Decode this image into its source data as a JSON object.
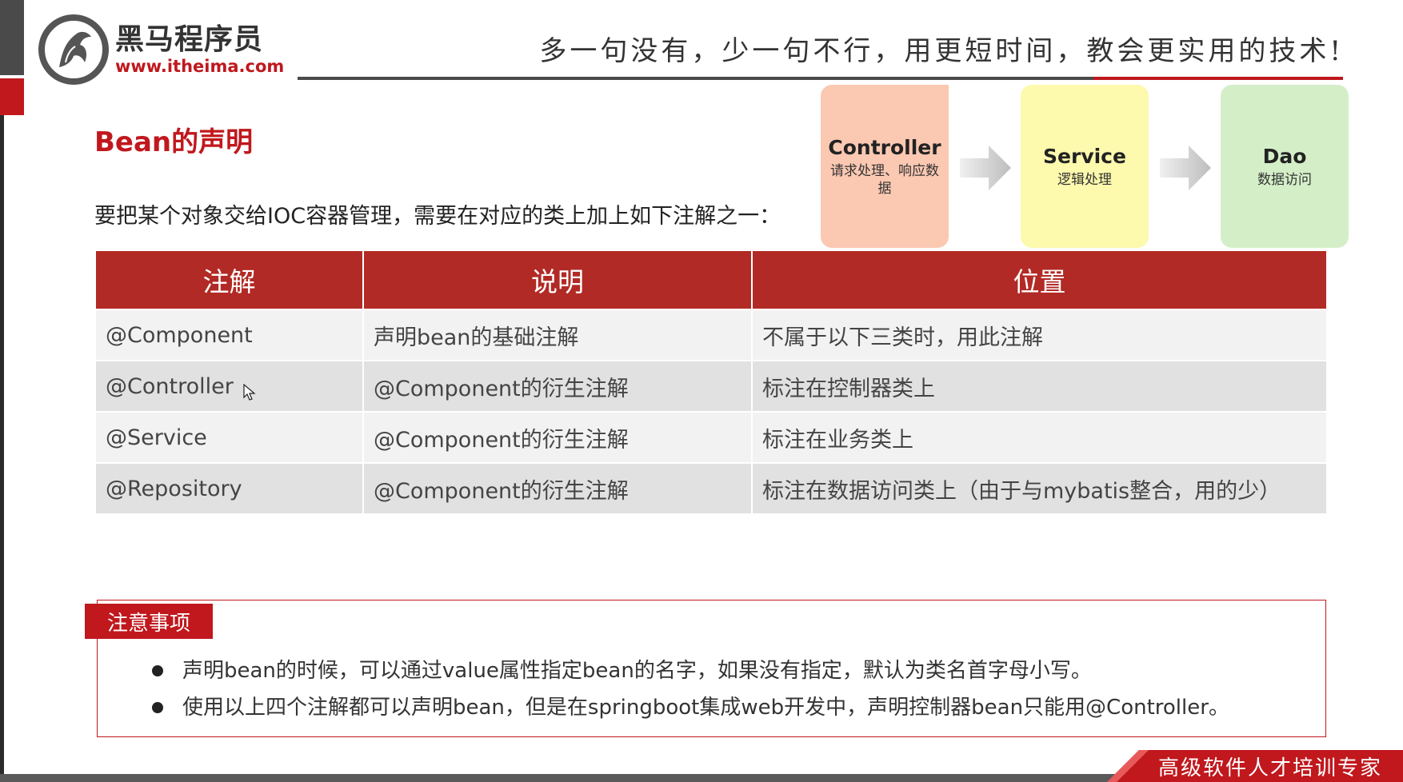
{
  "header": {
    "logo_name": "黑马程序员",
    "logo_url": "www.itheima.com",
    "slogan": "多一句没有，少一句不行，用更短时间，教会更实用的技术!"
  },
  "page": {
    "title": "Bean的声明",
    "intro": "要把某个对象交给IOC容器管理，需要在对应的类上加上如下注解之一："
  },
  "flow": [
    {
      "title": "Controller",
      "subtitle": "请求处理、响应数据"
    },
    {
      "title": "Service",
      "subtitle": "逻辑处理"
    },
    {
      "title": "Dao",
      "subtitle": "数据访问"
    }
  ],
  "table": {
    "headers": [
      "注解",
      "说明",
      "位置"
    ],
    "rows": [
      [
        "@Component",
        "声明bean的基础注解",
        "不属于以下三类时，用此注解"
      ],
      [
        "@Controller",
        "@Component的衍生注解",
        "标注在控制器类上"
      ],
      [
        "@Service",
        "@Component的衍生注解",
        "标注在业务类上"
      ],
      [
        "@Repository",
        "@Component的衍生注解",
        "标注在数据访问类上（由于与mybatis整合，用的少）"
      ]
    ]
  },
  "note": {
    "tag": "注意事项",
    "items": [
      "声明bean的时候，可以通过value属性指定bean的名字，如果没有指定，默认为类名首字母小写。",
      "使用以上四个注解都可以声明bean，但是在springboot集成web开发中，声明控制器bean只能用@Controller。"
    ]
  },
  "footer": {
    "badge_text": "高级软件人才培训专家"
  },
  "colors": {
    "brand_red": "#c0181d",
    "table_header": "#b22a25",
    "controller_box": "#fbc8b2",
    "service_box": "#fdf9ad",
    "dao_box": "#d4efc8"
  }
}
